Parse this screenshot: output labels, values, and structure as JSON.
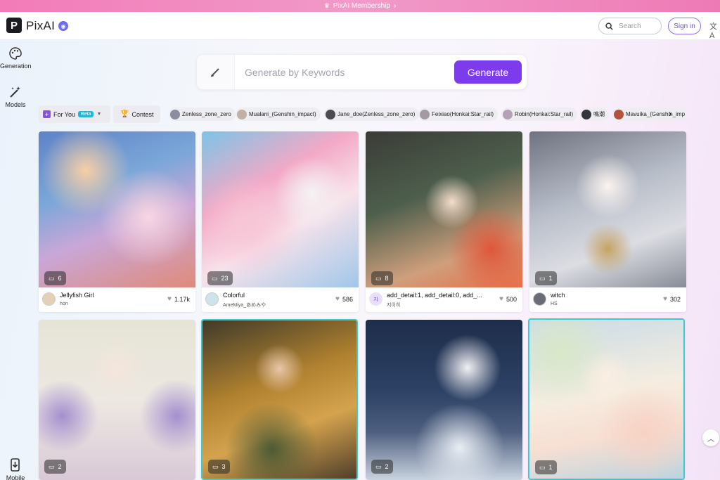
{
  "promo": {
    "label": "PixAI Membership",
    "arrow": "›"
  },
  "header": {
    "logo_letter": "P",
    "brand": "PixAI",
    "search_placeholder": "Search",
    "signin_label": "Sign in",
    "lang_icon": "文A"
  },
  "sidebar": {
    "generation": "Generation",
    "models": "Models",
    "mobile_app": "Mobile App"
  },
  "generate": {
    "placeholder": "Generate by Keywords",
    "button": "Generate"
  },
  "filters": {
    "for_you": "For You",
    "beta": "Beta",
    "contest": "Contest",
    "chips": [
      "Zenless_zone_zero",
      "Mualani_(Genshin_impact)",
      "Jane_doe(Zenless_zone_zero)",
      "Feixiao(Honkai:Star_rail)",
      "Robin(Honkai:Star_rail)",
      "鳴潮",
      "Mavuika_(Genshin_imp"
    ]
  },
  "cards": [
    {
      "comments": "6",
      "title": "Jellyfish Girl",
      "user": "hon",
      "likes": "1.17k"
    },
    {
      "comments": "23",
      "title": "Colorful",
      "user": "AmeMiya_あめみや",
      "likes": "586"
    },
    {
      "comments": "8",
      "title": "add_detail:1, add_detail:0, add_...",
      "user": "지이히",
      "likes": "500",
      "avatar_text": "지"
    },
    {
      "comments": "1",
      "title": "witch",
      "user": "HS",
      "likes": "302"
    },
    {
      "comments": "2"
    },
    {
      "comments": "3"
    },
    {
      "comments": "2"
    },
    {
      "comments": "1"
    }
  ],
  "colors": {
    "accent": "#7d3cec",
    "promo": "#f27bb8",
    "highlight_border": "#3ccad6"
  }
}
